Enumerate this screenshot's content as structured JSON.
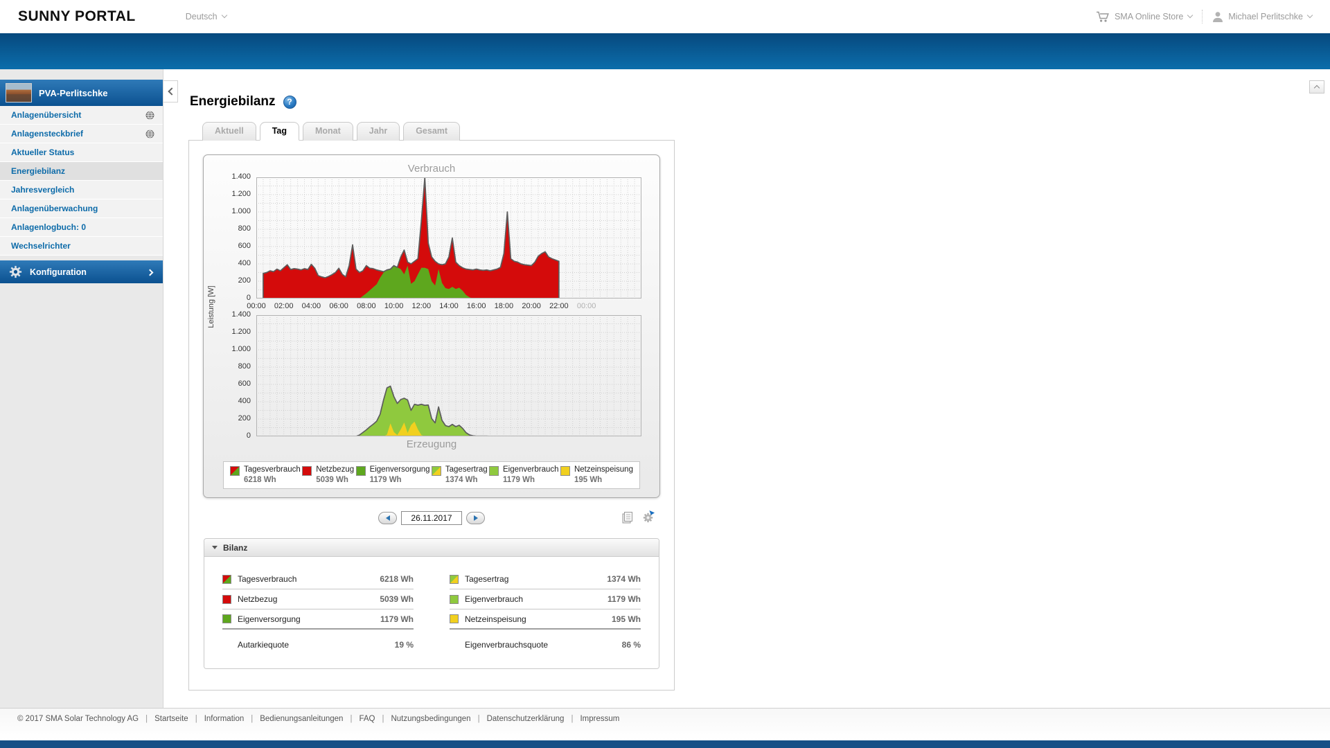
{
  "header": {
    "logo": "SUNNY PORTAL",
    "language": "Deutsch",
    "store_label": "SMA Online Store",
    "user_name": "Michael Perlitschke"
  },
  "sidebar": {
    "plant_name": "PVA-Perlitschke",
    "items": [
      {
        "label": "Anlagenübersicht",
        "globe": true,
        "active": false
      },
      {
        "label": "Anlagensteckbrief",
        "globe": true,
        "active": false
      },
      {
        "label": "Aktueller Status",
        "globe": false,
        "active": false
      },
      {
        "label": "Energiebilanz",
        "globe": false,
        "active": true
      },
      {
        "label": "Jahresvergleich",
        "globe": false,
        "active": false
      },
      {
        "label": "Anlagenüberwachung",
        "globe": false,
        "active": false
      },
      {
        "label": "Anlagenlogbuch: 0",
        "globe": false,
        "active": false
      },
      {
        "label": "Wechselrichter",
        "globe": false,
        "active": false
      }
    ],
    "config_label": "Konfiguration"
  },
  "page": {
    "title": "Energiebilanz",
    "help_glyph": "?",
    "tabs": [
      {
        "label": "Aktuell",
        "active": false
      },
      {
        "label": "Tag",
        "active": true
      },
      {
        "label": "Monat",
        "active": false
      },
      {
        "label": "Jahr",
        "active": false
      },
      {
        "label": "Gesamt",
        "active": false
      }
    ],
    "date_value": "26.11.2017"
  },
  "colors": {
    "red": "#d40b0b",
    "green_dark": "#5ea71e",
    "green_light": "#8fc93e",
    "yellow": "#f1d01f",
    "accent_blue": "#0d6ba9"
  },
  "chart_data": {
    "type": "area",
    "title_top": "Verbrauch",
    "title_bottom": "Erzeugung",
    "ylabel": "Leistung [W]",
    "ylim": [
      0,
      1400
    ],
    "y_minor_step": 100,
    "ytick_labels": [
      "1.400",
      "1.200",
      "1.000",
      "800",
      "600",
      "400",
      "200",
      "0"
    ],
    "xtick_labels": [
      "00:00",
      "02:00",
      "04:00",
      "06:00",
      "08:00",
      "10:00",
      "12:00",
      "14:00",
      "16:00",
      "18:00",
      "20:00",
      "22:00",
      "00:00"
    ],
    "x_step_minutes": 15,
    "x_hours_total": 24,
    "display_hours": 28,
    "grid": true,
    "daily_totals": {
      "tagesverbrauch_wh": 6218,
      "netzbezug_wh": 5039,
      "eigenversorgung_wh": 1179,
      "tagesertrag_wh": 1374,
      "eigenverbrauch_wh": 1179,
      "netzeinspeisung_wh": 195,
      "autarkiequote_pct": 19,
      "eigenverbrauchsquote_pct": 86
    },
    "series": [
      {
        "name": "Verbrauch gesamt",
        "chart": "top",
        "color_key": "red",
        "outline": true,
        "values": [
          null,
          null,
          290,
          300,
          320,
          310,
          340,
          320,
          355,
          390,
          335,
          345,
          340,
          330,
          345,
          335,
          395,
          350,
          265,
          250,
          240,
          255,
          275,
          300,
          350,
          280,
          250,
          380,
          620,
          340,
          300,
          320,
          380,
          350,
          345,
          330,
          320,
          310,
          330,
          340,
          380,
          360,
          480,
          560,
          420,
          400,
          430,
          460,
          900,
          1400,
          640,
          480,
          430,
          400,
          390,
          400,
          480,
          700,
          420,
          380,
          355,
          340,
          335,
          330,
          340,
          330,
          325,
          330,
          320,
          330,
          340,
          360,
          520,
          1000,
          460,
          430,
          420,
          400,
          390,
          385,
          380,
          420,
          490,
          520,
          540,
          480,
          460,
          445,
          430,
          null,
          null,
          null,
          null,
          null,
          null,
          null,
          null
        ]
      },
      {
        "name": "Eigenversorgung",
        "chart": "top",
        "color_key": "green_dark",
        "outline": false,
        "values": [
          null,
          null,
          0,
          0,
          0,
          0,
          0,
          0,
          0,
          0,
          0,
          0,
          0,
          0,
          0,
          0,
          0,
          0,
          0,
          0,
          0,
          0,
          0,
          0,
          0,
          0,
          0,
          0,
          0,
          0,
          0,
          30,
          60,
          95,
          130,
          165,
          240,
          300,
          330,
          340,
          380,
          360,
          340,
          280,
          380,
          170,
          200,
          280,
          355,
          355,
          340,
          200,
          150,
          340,
          180,
          120,
          110,
          135,
          110,
          125,
          90,
          40,
          15,
          0,
          0,
          0,
          0,
          0,
          0,
          0,
          0,
          0,
          0,
          0,
          0,
          0,
          0,
          0,
          0,
          0,
          0,
          0,
          0,
          0,
          0,
          0,
          0,
          0,
          0,
          null,
          null,
          null,
          null,
          null,
          null,
          null,
          null
        ]
      },
      {
        "name": "Erzeugung gesamt",
        "chart": "bottom",
        "color_key": "green_light",
        "outline": true,
        "values": [
          0,
          0,
          0,
          0,
          0,
          0,
          0,
          0,
          0,
          0,
          0,
          0,
          0,
          0,
          0,
          0,
          0,
          0,
          0,
          0,
          0,
          0,
          0,
          0,
          0,
          0,
          0,
          0,
          0,
          0,
          15,
          45,
          75,
          110,
          140,
          175,
          255,
          420,
          560,
          580,
          460,
          380,
          425,
          440,
          420,
          300,
          370,
          360,
          370,
          358,
          362,
          205,
          155,
          340,
          185,
          125,
          112,
          138,
          112,
          128,
          92,
          42,
          16,
          6,
          2,
          2,
          2,
          2,
          0,
          null,
          null,
          null,
          null,
          null,
          null,
          null,
          null,
          null,
          null,
          null,
          null,
          null,
          null,
          null,
          null,
          null,
          null,
          null,
          null,
          null,
          null,
          null,
          null,
          null,
          null,
          null,
          null
        ]
      },
      {
        "name": "Netzeinspeisung",
        "chart": "bottom",
        "color_key": "yellow",
        "outline": false,
        "values": [
          0,
          0,
          0,
          0,
          0,
          0,
          0,
          0,
          0,
          0,
          0,
          0,
          0,
          0,
          0,
          0,
          0,
          0,
          0,
          0,
          0,
          0,
          0,
          0,
          0,
          0,
          0,
          0,
          0,
          0,
          0,
          0,
          0,
          0,
          0,
          0,
          0,
          0,
          20,
          150,
          50,
          15,
          80,
          160,
          40,
          130,
          170,
          80,
          15,
          0,
          0,
          0,
          0,
          0,
          0,
          0,
          0,
          0,
          0,
          0,
          0,
          0,
          0,
          0,
          0,
          0,
          0,
          0,
          0,
          null,
          null,
          null,
          null,
          null,
          null,
          null,
          null,
          null,
          null,
          null,
          null,
          null,
          null,
          null,
          null,
          null,
          null,
          null,
          null,
          null,
          null,
          null,
          null,
          null,
          null,
          null,
          null,
          null
        ]
      }
    ],
    "legend": [
      {
        "label": "Tagesverbrauch",
        "value": "6218 Wh",
        "swatch": "split_red_green"
      },
      {
        "label": "Netzbezug",
        "value": "5039 Wh",
        "swatch": "red"
      },
      {
        "label": "Eigenversorgung",
        "value": "1179 Wh",
        "swatch": "green_dark"
      },
      {
        "label": "Tagesertrag",
        "value": "1374 Wh",
        "swatch": "split_green_yellow"
      },
      {
        "label": "Eigenverbrauch",
        "value": "1179 Wh",
        "swatch": "green_light"
      },
      {
        "label": "Netzeinspeisung",
        "value": "195 Wh",
        "swatch": "yellow"
      }
    ]
  },
  "bilanz": {
    "header": "Bilanz",
    "left_rows": [
      {
        "label": "Tagesverbrauch",
        "value": "6218 Wh",
        "swatch": "split_red_green"
      },
      {
        "label": "Netzbezug",
        "value": "5039 Wh",
        "swatch": "red"
      },
      {
        "label": "Eigenversorgung",
        "value": "1179 Wh",
        "swatch": "green_dark"
      }
    ],
    "right_rows": [
      {
        "label": "Tagesertrag",
        "value": "1374 Wh",
        "swatch": "split_green_yellow"
      },
      {
        "label": "Eigenverbrauch",
        "value": "1179 Wh",
        "swatch": "green_light"
      },
      {
        "label": "Netzeinspeisung",
        "value": "195 Wh",
        "swatch": "yellow"
      }
    ],
    "left_summary": {
      "label": "Autarkiequote",
      "value": "19 %"
    },
    "right_summary": {
      "label": "Eigenverbrauchsquote",
      "value": "86 %"
    }
  },
  "footer": {
    "copyright": "© 2017 SMA Solar Technology AG",
    "separator": "|",
    "links": [
      "Startseite",
      "Information",
      "Bedienungsanleitungen",
      "FAQ",
      "Nutzungsbedingungen",
      "Datenschutzerklärung",
      "Impressum"
    ]
  }
}
